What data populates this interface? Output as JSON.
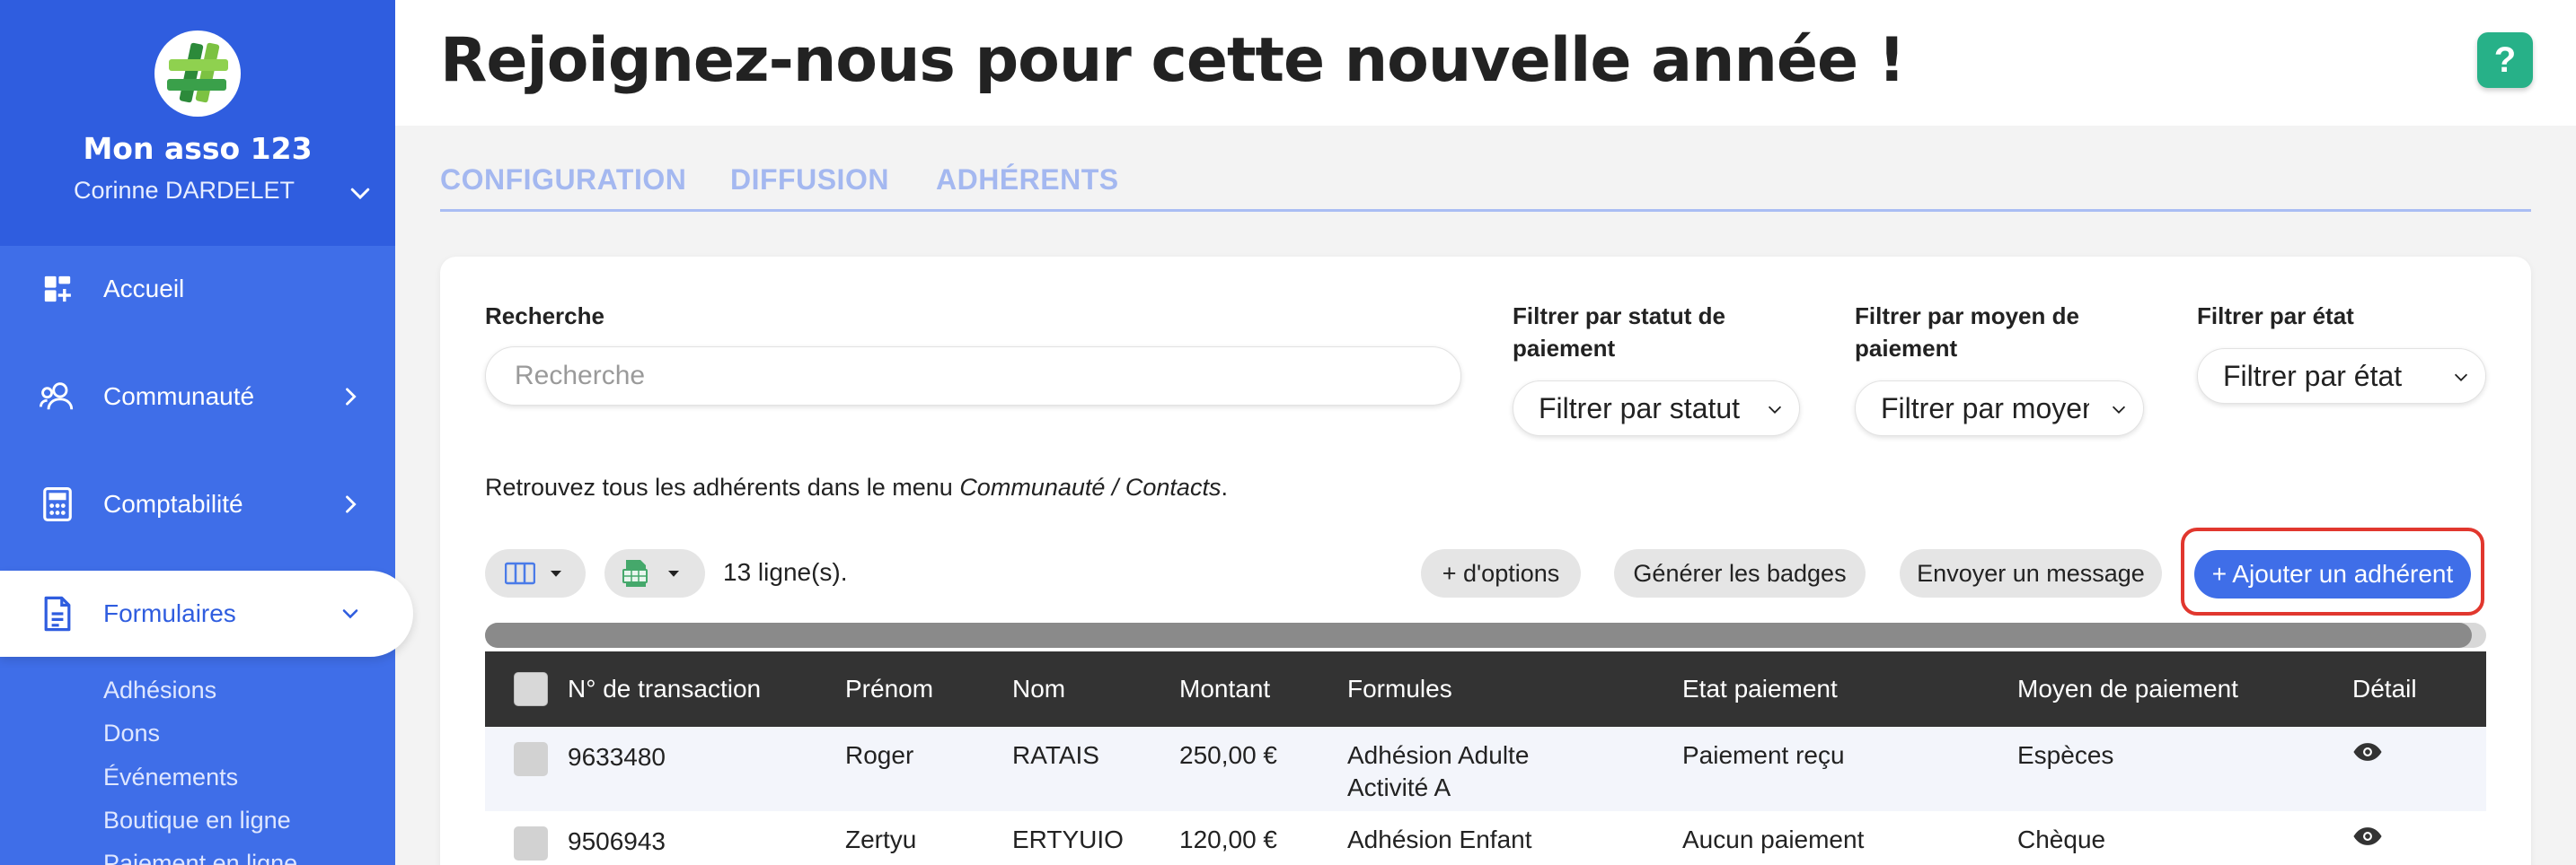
{
  "org": {
    "name": "Mon asso 123",
    "user": "Corinne DARDELET"
  },
  "sidebar": {
    "items": [
      {
        "label": "Accueil",
        "icon": "dashboard-icon"
      },
      {
        "label": "Communauté",
        "icon": "community-icon"
      },
      {
        "label": "Comptabilité",
        "icon": "calculator-icon"
      },
      {
        "label": "Formulaires",
        "icon": "document-icon"
      }
    ],
    "subitems": [
      "Adhésions",
      "Dons",
      "Événements",
      "Boutique en ligne",
      "Paiement en ligne"
    ]
  },
  "header": {
    "title": "Rejoignez-nous pour cette nouvelle année !",
    "help": "?"
  },
  "tabs": [
    "CONFIGURATION",
    "DIFFUSION",
    "ADHÉRENTS"
  ],
  "filters": {
    "search_label": "Recherche",
    "search_placeholder": "Recherche",
    "payment_status_label": "Filtrer par statut de paiement",
    "payment_status_value": "Filtrer par statut de paiement",
    "payment_method_label": "Filtrer par moyen de paiement",
    "payment_method_value": "Filtrer par moyen de paiement",
    "state_label": "Filtrer par état",
    "state_value": "Filtrer par état"
  },
  "info": {
    "text": "Retrouvez tous les adhérents dans le menu ",
    "path": "Communauté / Contacts",
    "end": "."
  },
  "toolbar": {
    "rows_count": "13 ligne(s).",
    "more_options": "+ d'options",
    "badges": "Générer les badges",
    "message": "Envoyer un message",
    "add": "+ Ajouter un adhérent"
  },
  "table": {
    "headers": [
      "N° de transaction",
      "Prénom",
      "Nom",
      "Montant",
      "Formules",
      "Etat paiement",
      "Moyen de paiement",
      "Détail"
    ],
    "rows": [
      {
        "id": "9633480",
        "first": "Roger",
        "last": "RATAIS",
        "amount": "250,00 €",
        "formula_1": "Adhésion Adulte",
        "formula_2": "Activité A",
        "status": "Paiement reçu",
        "method": "Espèces"
      },
      {
        "id": "9506943",
        "first": "Zertyu",
        "last": "ERTYUIO",
        "amount": "120,00 €",
        "formula_1": "Adhésion Enfant",
        "formula_2": "",
        "status": "Aucun paiement",
        "method": "Chèque"
      }
    ]
  },
  "colors": {
    "sidebar": "#3f6ee8",
    "sidebar_top": "#2f5ddf",
    "help": "#27b188",
    "primary": "#3f6ee8",
    "highlight": "#e1372e",
    "table_header": "#333333"
  }
}
